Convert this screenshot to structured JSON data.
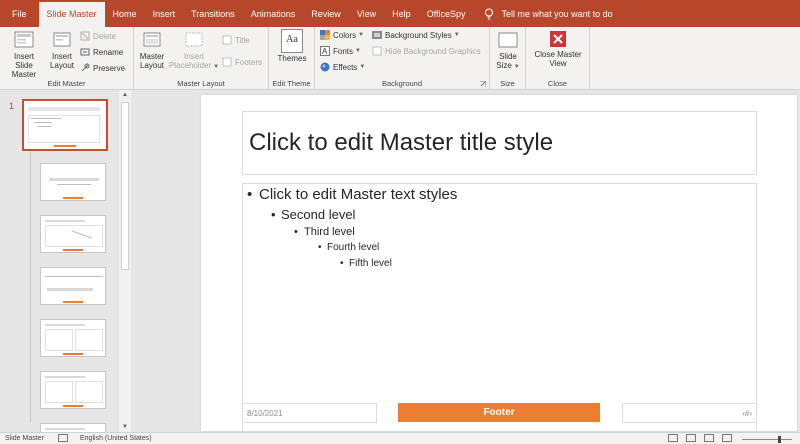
{
  "tabs": {
    "file": "File",
    "slide_master": "Slide Master",
    "home": "Home",
    "insert": "Insert",
    "transitions": "Transitions",
    "animations": "Animations",
    "review": "Review",
    "view": "View",
    "help": "Help",
    "officespy": "OfficeSpy",
    "tell_me": "Tell me what you want to do"
  },
  "ribbon": {
    "edit_master": {
      "label": "Edit Master",
      "insert_slide_master": "Insert Slide Master",
      "insert_layout": "Insert Layout",
      "delete": "Delete",
      "rename": "Rename",
      "preserve": "Preserve"
    },
    "master_layout": {
      "label": "Master Layout",
      "master_layout": "Master Layout",
      "insert_placeholder": "Insert Placeholder",
      "title": "Title",
      "footers": "Footers"
    },
    "edit_theme": {
      "label": "Edit Theme",
      "themes": "Themes",
      "themes_icon_text": "Aa"
    },
    "background": {
      "label": "Background",
      "colors": "Colors",
      "fonts": "Fonts",
      "effects": "Effects",
      "background_styles": "Background Styles",
      "hide_background_graphics": "Hide Background Graphics"
    },
    "size": {
      "label": "Size",
      "slide_size": "Slide Size"
    },
    "close": {
      "label": "Close",
      "close_master_view": "Close Master View"
    }
  },
  "thumbnails": {
    "slide_number": "1"
  },
  "slide": {
    "title": "Click to edit Master title style",
    "levels": [
      "Click to edit Master text styles",
      "Second level",
      "Third level",
      "Fourth level",
      "Fifth level"
    ],
    "date": "8/10/2021",
    "footer": "Footer",
    "number": "‹#›"
  },
  "status": {
    "view": "Slide Master",
    "language": "English (United States)"
  },
  "colors": {
    "accent": "#b7472a",
    "footer": "#ed7d31",
    "close_red": "#d13438"
  }
}
